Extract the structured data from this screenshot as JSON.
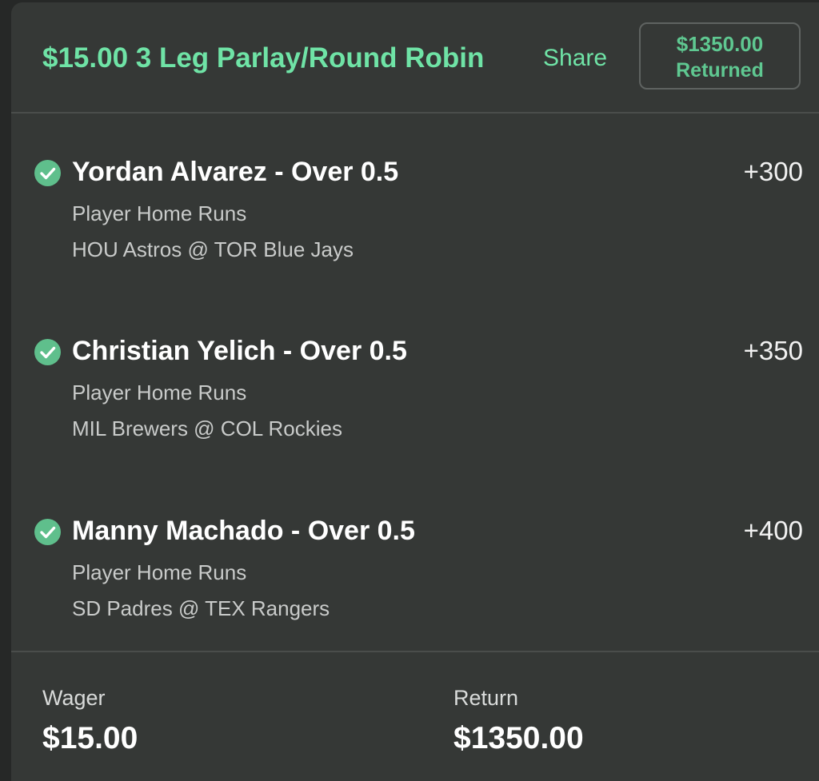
{
  "header": {
    "title": "$15.00 3 Leg Parlay/Round Robin",
    "share_label": "Share",
    "returned_amount": "$1350.00",
    "returned_label": "Returned"
  },
  "legs": [
    {
      "status_icon": "check-circle-icon",
      "title": "Yordan Alvarez - Over 0.5",
      "odds": "+300",
      "market": "Player Home Runs",
      "game": "HOU Astros @ TOR Blue Jays"
    },
    {
      "status_icon": "check-circle-icon",
      "title": "Christian Yelich - Over 0.5",
      "odds": "+350",
      "market": "Player Home Runs",
      "game": "MIL Brewers @ COL Rockies"
    },
    {
      "status_icon": "check-circle-icon",
      "title": "Manny Machado - Over 0.5",
      "odds": "+400",
      "market": "Player Home Runs",
      "game": "SD Padres @ TEX Rangers"
    }
  ],
  "footer": {
    "wager_label": "Wager",
    "wager_value": "$15.00",
    "return_label": "Return",
    "return_value": "$1350.00"
  },
  "colors": {
    "accent": "#6fe3a6",
    "win_check": "#5fbf8c",
    "card_bg": "#353836",
    "page_bg": "#262827"
  }
}
